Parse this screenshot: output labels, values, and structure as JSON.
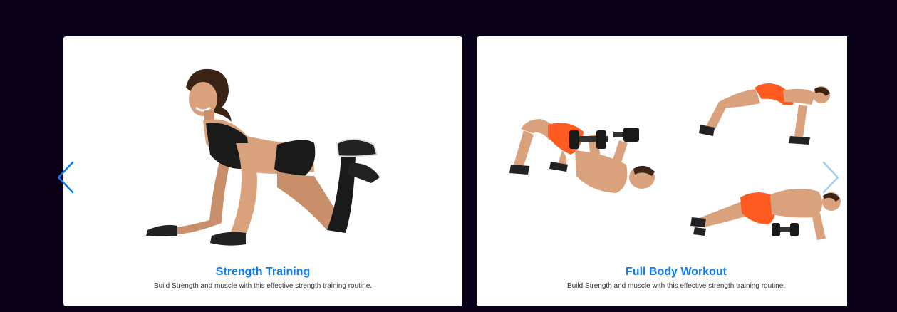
{
  "colors": {
    "page_background": "#0a0118",
    "card_background": "#ffffff",
    "title": "#0a7cf2",
    "description": "#333333",
    "arrow_prev": "#0a7cf2",
    "arrow_next": "#9fcdf5"
  },
  "carousel": {
    "prev_icon": "chevron-left-icon",
    "next_icon": "chevron-right-icon",
    "cards": [
      {
        "title": "Strength Training",
        "description": "Build Strength and muscle with this effective strength training routine.",
        "image": "woman-kneeling-pushup-photo"
      },
      {
        "title": "Full Body Workout",
        "description": "Build Strength and muscle with this effective strength training routine.",
        "image": "man-dumbbell-exercises-photo"
      }
    ]
  }
}
